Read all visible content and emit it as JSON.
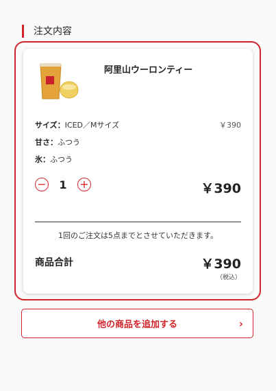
{
  "section": {
    "title": "注文内容"
  },
  "item": {
    "name": "阿里山ウーロンティー",
    "options": [
      {
        "label": "サイズ：",
        "value": "ICED／Mサイズ",
        "price": "￥390"
      },
      {
        "label": "甘さ：",
        "value": "ふつう"
      },
      {
        "label": "氷：",
        "value": "ふつう"
      }
    ],
    "qty_minus_icon": "minus-circle-icon",
    "qty_plus_icon": "plus-circle-icon",
    "quantity": "1",
    "line_price": "￥390"
  },
  "notice": "1回のご注文は5点までとさせていただきます。",
  "subtotal": {
    "label": "商品合計",
    "price": "￥390",
    "tax_note": "（税込）"
  },
  "add_button": {
    "label": "他の商品を追加する",
    "icon": "chevron-right-icon"
  },
  "colors": {
    "accent": "#d2232a",
    "background": "#fafafa"
  }
}
